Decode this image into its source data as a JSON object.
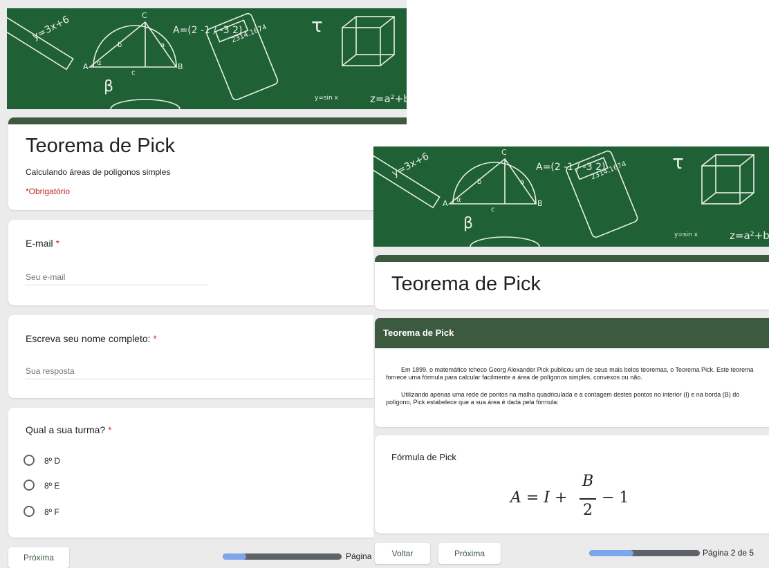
{
  "left_form": {
    "title": "Teorema de Pick",
    "description": "Calculando áreas de polígonos simples",
    "required_note": "*Obrigatório",
    "email": {
      "label": "E-mail",
      "required_mark": "*",
      "placeholder": "Seu e-mail"
    },
    "name": {
      "label": "Escreva seu nome completo:",
      "required_mark": "*",
      "placeholder": "Sua resposta"
    },
    "class_question": {
      "label": "Qual a sua turma?",
      "required_mark": "*",
      "options": [
        "8º D",
        "8º E",
        "8º F"
      ]
    },
    "next_button": "Próxima",
    "page_text": "Página",
    "progress": 0.2
  },
  "right_form": {
    "title": "Teorema de Pick",
    "section_title": "Teorema de Pick",
    "paragraph1": "Em 1899, o matemático tcheco Georg Alexander Pick publicou um de seus mais belos teoremas, o Teorema Pick. Este teorema fornece uma fórmula para calcular facilmente a área de polígonos simples, convexos ou não.",
    "paragraph2": "Utilizando apenas uma rede de pontos na malha  quadriculada e a contagem destes pontos  no interior (I) e na borda (B) do polígono, Pick estabelece que a sua área é dada pela fórmula:",
    "formula_label": "Fórmula de Pick",
    "formula": {
      "lhs": "A = I +",
      "numerator": "B",
      "denominator": "2",
      "tail": "− 1"
    },
    "back_button": "Voltar",
    "next_button": "Próxima",
    "page_text": "Página 2 de 5",
    "progress": 0.4
  },
  "banner": {
    "background": "#1f6135",
    "texts": [
      "y=3x+6",
      "A=(2 -1 / -3 2)",
      "τ",
      "β",
      "C",
      "A",
      "B",
      "b",
      "a",
      "c",
      "α",
      "2314.1674",
      "y=sin x",
      "z=a²+b"
    ]
  },
  "colors": {
    "theme": "#3c5a3f",
    "progress_fill": "#7ea6ea",
    "required": "#d93025"
  }
}
